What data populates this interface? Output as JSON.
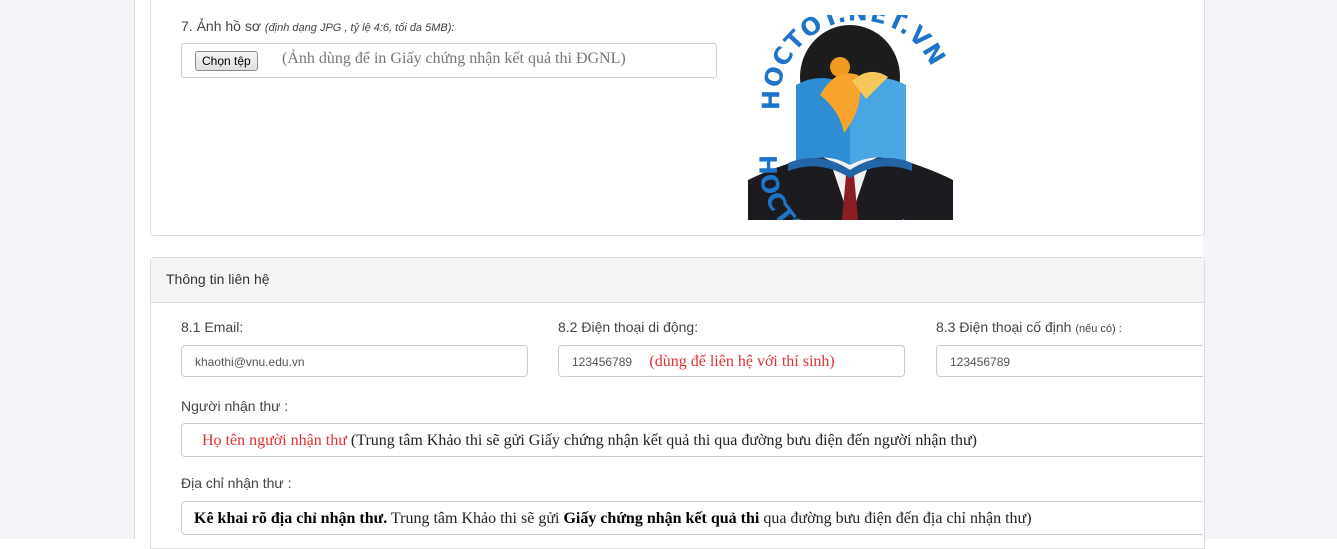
{
  "photo_section": {
    "label": "7. Ảnh hồ sơ",
    "label_hint": "(định dạng JPG , tỷ lệ 4:6, tối đa 5MB):",
    "choose_file_button": "Chọn tệp",
    "file_hint": "(Ảnh dùng để in Giấy chứng nhận kết quả thi ĐGNL)",
    "watermark_text": "HOCTOT.NET.VN"
  },
  "contact": {
    "title": "Thông tin liên hệ",
    "email_label": "8.1 Email:",
    "email_value": "khaothi@vnu.edu.vn",
    "mobile_label": "8.2 Điện thoại di động:",
    "mobile_value": "123456789",
    "mobile_note": "(dùng để liên hệ với thí sinh)",
    "landline_label": "8.3 Điện thoại cố định",
    "landline_label_small": "(nếu có) :",
    "landline_value": "123456789",
    "recipient_label": "Người nhận thư :",
    "recipient_red": "Họ tên người nhận thư",
    "recipient_rest": " (Trung tâm Khảo thi sẽ gửi Giấy chứng nhận kết quả thi qua đường bưu điện đến người nhận thư)",
    "address_label": "Địa chỉ nhận thư :",
    "address_bold1": "Kê khai rõ địa chỉ nhận thư.",
    "address_text1": " Trung tâm Khảo thi sẽ gửi ",
    "address_bold2": "Giấy chứng nhận kết quả thi",
    "address_text2": " qua đường bưu điện đến địa chỉ nhận thư)"
  }
}
